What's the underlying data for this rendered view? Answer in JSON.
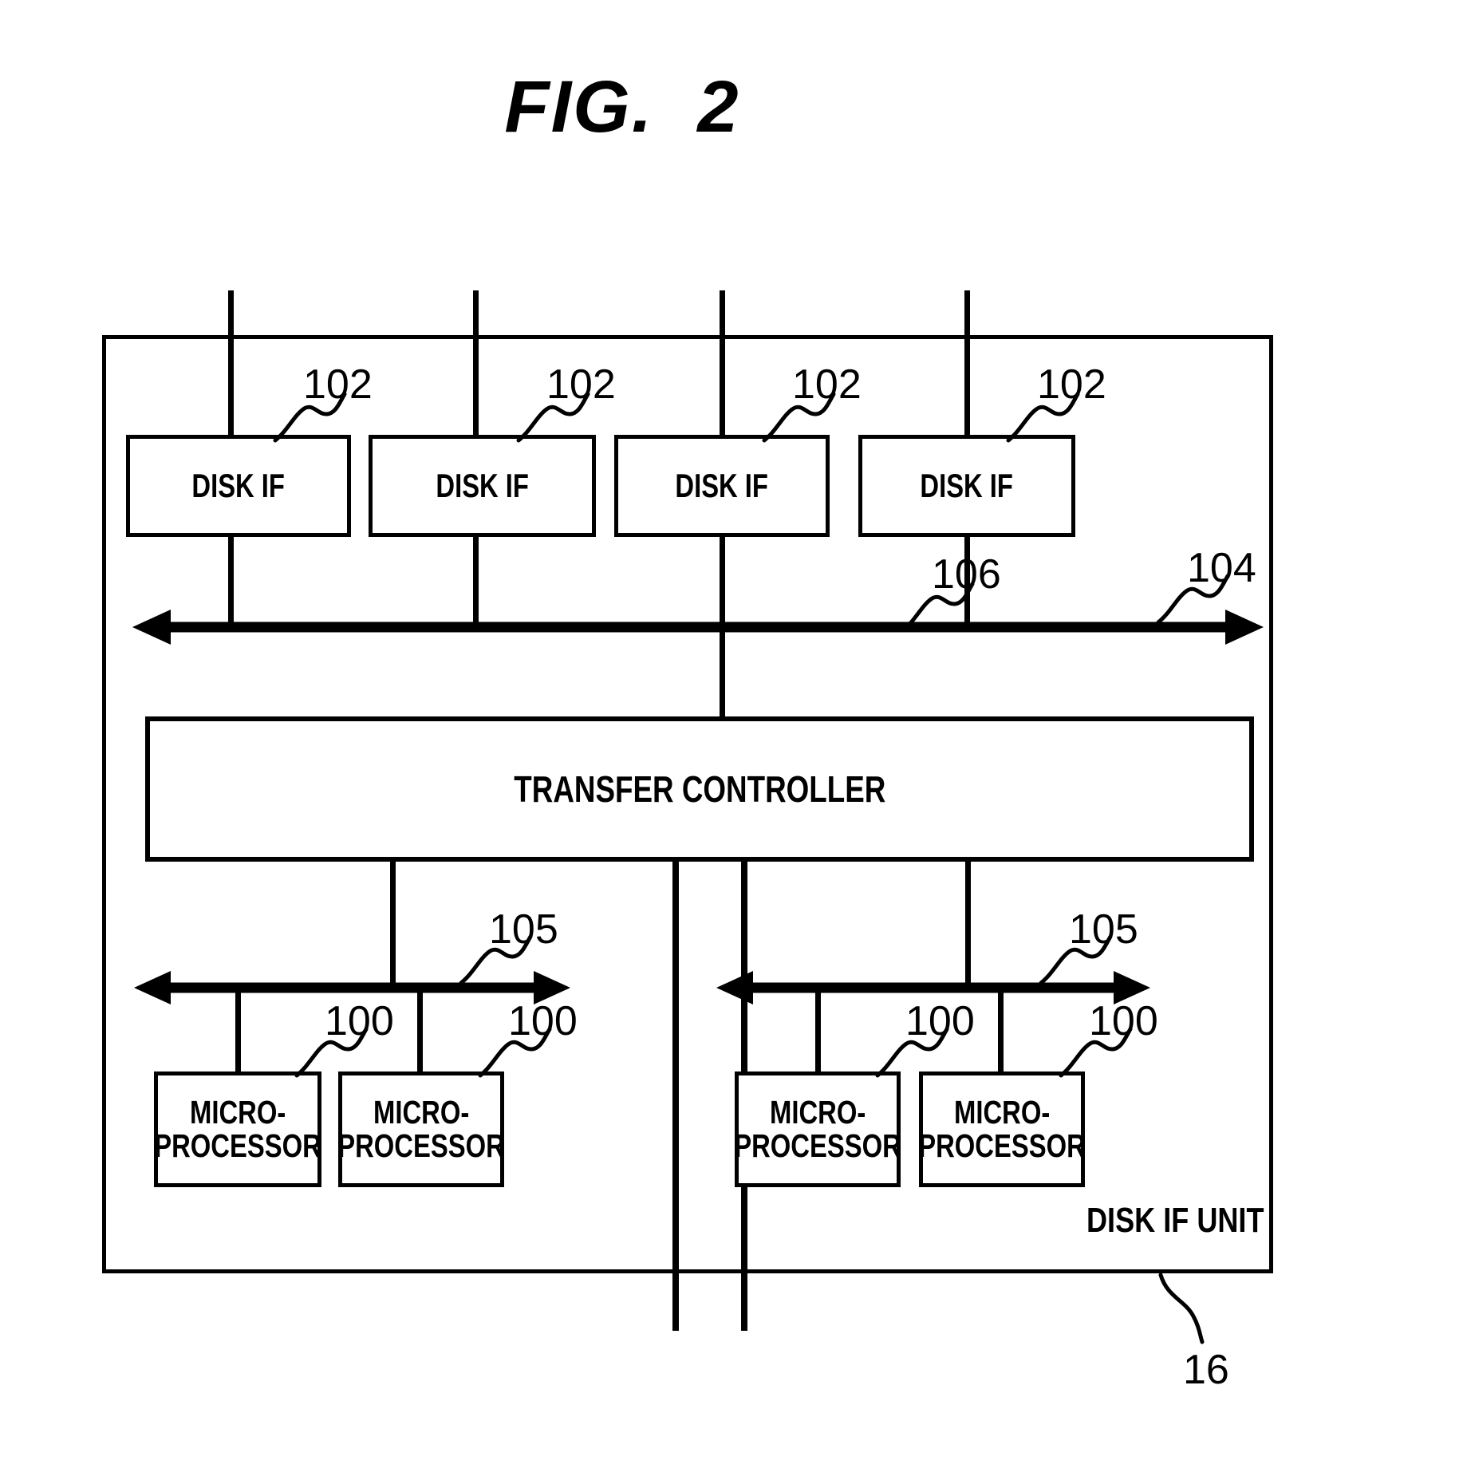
{
  "figure": {
    "title": "FIG.  2",
    "unit_label": "DISK IF UNIT",
    "unit_ref": "16"
  },
  "disk_if_boxes": [
    {
      "label": "DISK IF",
      "ref": "102"
    },
    {
      "label": "DISK IF",
      "ref": "102"
    },
    {
      "label": "DISK IF",
      "ref": "102"
    },
    {
      "label": "DISK IF",
      "ref": "102"
    }
  ],
  "bus_upper": {
    "ref": "104"
  },
  "bus_link": {
    "ref": "106"
  },
  "transfer_controller": {
    "label": "TRANSFER CONTROLLER"
  },
  "bus_lower": [
    {
      "ref": "105"
    },
    {
      "ref": "105"
    }
  ],
  "microprocessors": [
    {
      "line1": "MICRO-",
      "line2": "PROCESSOR",
      "ref": "100"
    },
    {
      "line1": "MICRO-",
      "line2": "PROCESSOR",
      "ref": "100"
    },
    {
      "line1": "MICRO-",
      "line2": "PROCESSOR",
      "ref": "100"
    },
    {
      "line1": "MICRO-",
      "line2": "PROCESSOR",
      "ref": "100"
    }
  ],
  "colors": {
    "ink": "#000000",
    "paper": "#ffffff"
  }
}
